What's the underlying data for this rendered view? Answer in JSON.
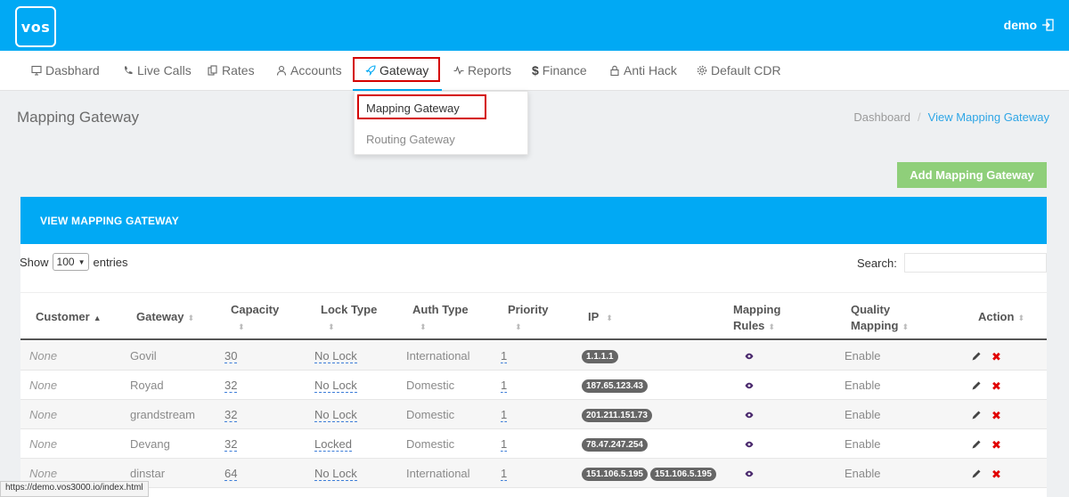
{
  "app": {
    "logo": "vos",
    "user": "demo"
  },
  "nav": {
    "items": [
      {
        "label": "Dasbhard"
      },
      {
        "label": "Live Calls"
      },
      {
        "label": "Rates"
      },
      {
        "label": "Accounts"
      },
      {
        "label": "Gateway"
      },
      {
        "label": "Reports"
      },
      {
        "label": "Finance"
      },
      {
        "label": "Anti Hack"
      },
      {
        "label": "Default CDR"
      }
    ],
    "active": "Gateway"
  },
  "dropdown": {
    "items": [
      "Mapping Gateway",
      "Routing Gateway"
    ],
    "selected": "Mapping Gateway"
  },
  "page": {
    "title": "Mapping Gateway",
    "breadcrumb": {
      "home": "Dashboard",
      "separator": "/",
      "current": "View Mapping Gateway"
    },
    "add_button": "Add Mapping Gateway"
  },
  "card": {
    "title": "VIEW MAPPING GATEWAY"
  },
  "table_controls": {
    "show": "Show",
    "entries_value": "100",
    "entries": "entries",
    "search_label": "Search:"
  },
  "table": {
    "headers": {
      "customer": "Customer",
      "gateway": "Gateway",
      "capacity": "Capacity",
      "lock_type": "Lock Type",
      "auth_type": "Auth Type",
      "priority": "Priority",
      "ip": "IP",
      "mapping_rules_1": "Mapping",
      "mapping_rules_2": "Rules",
      "quality_mapping_1": "Quality",
      "quality_mapping_2": "Mapping",
      "action": "Action"
    },
    "rows": [
      {
        "customer": "None",
        "gateway": "Govil",
        "capacity": "30",
        "lock": "No Lock",
        "auth": "International",
        "priority": "1",
        "ip1": "1.1.1.1",
        "ip2": "",
        "quality": "Enable"
      },
      {
        "customer": "None",
        "gateway": "Royad",
        "capacity": "32",
        "lock": "No Lock",
        "auth": "Domestic",
        "priority": "1",
        "ip1": "187.65.123.43",
        "ip2": "",
        "quality": "Enable"
      },
      {
        "customer": "None",
        "gateway": "grandstream",
        "capacity": "32",
        "lock": "No Lock",
        "auth": "Domestic",
        "priority": "1",
        "ip1": "201.211.151.73",
        "ip2": "",
        "quality": "Enable"
      },
      {
        "customer": "None",
        "gateway": "Devang",
        "capacity": "32",
        "lock": "Locked",
        "auth": "Domestic",
        "priority": "1",
        "ip1": "78.47.247.254",
        "ip2": "",
        "quality": "Enable"
      },
      {
        "customer": "None",
        "gateway": "dinstar",
        "capacity": "64",
        "lock": "No Lock",
        "auth": "International",
        "priority": "1",
        "ip1": "151.106.5.195",
        "ip2": "151.106.5.195",
        "quality": "Enable"
      }
    ]
  },
  "status_bar": "https://demo.vos3000.io/index.html",
  "colors": {
    "primary": "#01a9f4",
    "success": "#8fcf7a",
    "danger": "#e10000",
    "highlight": "#d40000"
  }
}
